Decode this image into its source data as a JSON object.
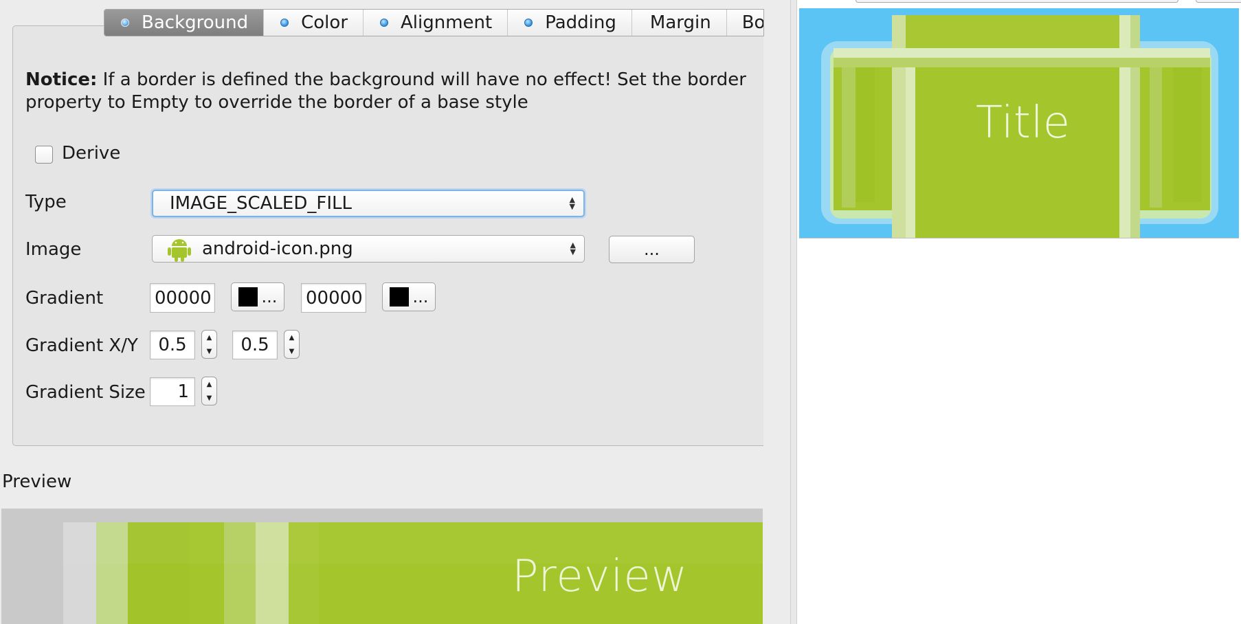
{
  "tabs": [
    {
      "label": "Background",
      "active": true,
      "dot": true
    },
    {
      "label": "Color",
      "active": false,
      "dot": true
    },
    {
      "label": "Alignment",
      "active": false,
      "dot": true
    },
    {
      "label": "Padding",
      "active": false,
      "dot": true
    },
    {
      "label": "Margin",
      "active": false,
      "dot": false
    },
    {
      "label": "Bo",
      "active": false,
      "dot": false
    }
  ],
  "notice": {
    "bold": "Notice:",
    "text": " If a border is defined the background will have no effect! Set the border property to Empty to override the border of a base style"
  },
  "derive": {
    "label": "Derive",
    "checked": false
  },
  "type": {
    "label": "Type",
    "value": "IMAGE_SCALED_FILL"
  },
  "image": {
    "label": "Image",
    "value": "android-icon.png",
    "browse": "..."
  },
  "gradient": {
    "label": "Gradient",
    "color1": "00000",
    "color2": "00000",
    "pick": "..."
  },
  "gradient_xy": {
    "label": "Gradient X/Y",
    "x": "0.5",
    "y": "0.5"
  },
  "gradient_size": {
    "label": "Gradient Size",
    "value": "1"
  },
  "preview": {
    "heading": "Preview",
    "text": "Preview"
  },
  "right_preview": {
    "text": "Title"
  },
  "colors": {
    "green": "#a4c52b",
    "sky": "#5bc4f5",
    "focus": "#7eb2e6"
  }
}
